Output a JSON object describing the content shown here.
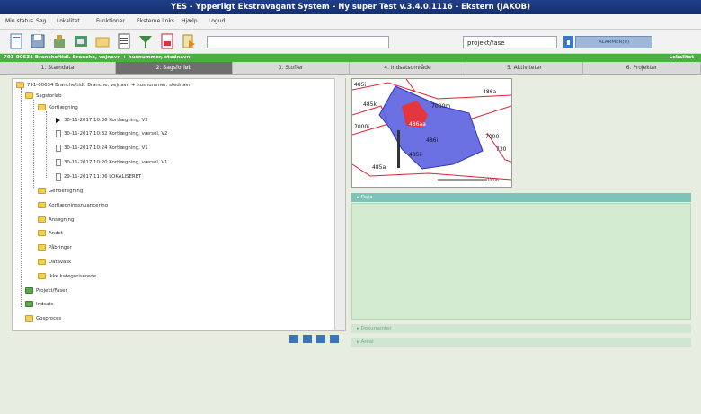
{
  "window": {
    "title": "YES - Ypperligt Ekstravagant System - Ny super Test v.3.4.0.1116 - Ekstern (JAKOB)"
  },
  "menu": {
    "items": [
      "Min status",
      "Søg",
      "Lokalitet",
      "Funktioner",
      "Eksterne links",
      "Hjælp",
      "Logud"
    ]
  },
  "toolbar": {
    "search_value": "",
    "project_value": "projekt/fase",
    "alarm_label": "ALARMER(0)"
  },
  "status": {
    "left": "791-00634 Branche/tidl. Branche, vejnavn + husnummer, stednavn",
    "right": "Lokalitet"
  },
  "tabs": [
    {
      "label": "1. Stamdata"
    },
    {
      "label": "2. Sagsforløb"
    },
    {
      "label": "3. Stoffer"
    },
    {
      "label": "4. Indsatsområde"
    },
    {
      "label": "5. Aktiviteter"
    },
    {
      "label": "6. Projekter"
    }
  ],
  "tree": {
    "root": "791-00634 Branche/tidl. Branche, vejnavn + husnummer, stednavn",
    "sagsforlob": "Sagsforløb",
    "kortlaegning": "Kortlægning",
    "docs": [
      "30-11-2017 10:36 Kortlægning, V2",
      "30-11-2017 10:32 Kortlægning, værsel, V2",
      "30-11-2017 10:24 Kortlægning, V1",
      "30-11-2017 10:20 Kortlægning, værsel, V1",
      "29-11-2017 11:06 LOKALISERET"
    ],
    "folders": [
      "Genberegning",
      "Kortlægningsnuancering",
      "Ansøgning",
      "Andet",
      "Påbringer",
      "Dataväsk",
      "Ikke kategoriserede"
    ],
    "projekt": "Projekt/Faser",
    "indsats": "Indsats",
    "gosproces": "Gosproces"
  },
  "map": {
    "labels": [
      "485i",
      "486a",
      "485k",
      "7000m",
      "7000i",
      "486aa",
      "486i",
      "485ii",
      "485a",
      "730",
      "7000"
    ],
    "scale": "100 m"
  },
  "panels": {
    "data": "Data",
    "dokumenter": "Dokumenter",
    "areal": "Areal"
  },
  "colors": {
    "title_bg": "#1d3a82",
    "status_green": "#4caf43",
    "panel_teal": "#7cc3b9",
    "panel_body": "#d3ecd1",
    "map_blue": "#5b62e0",
    "map_red": "#e3363f"
  }
}
